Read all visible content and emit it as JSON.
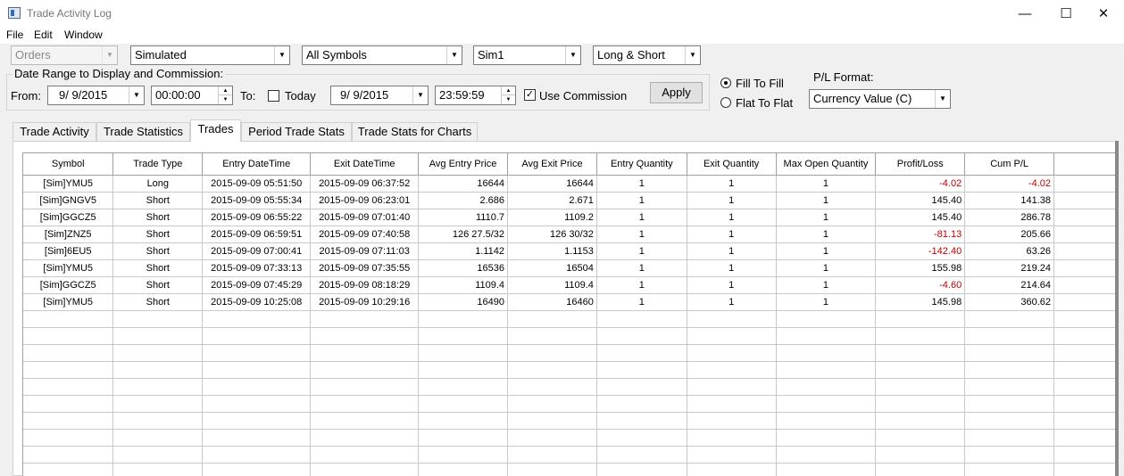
{
  "window": {
    "title": "Trade Activity Log",
    "minimize_glyph": "—",
    "maximize_glyph": "☐",
    "close_glyph": "✕"
  },
  "menu": [
    "File",
    "Edit",
    "Window"
  ],
  "filters": {
    "orders": "Orders",
    "mode": "Simulated",
    "symbols": "All Symbols",
    "account": "Sim1",
    "direction": "Long & Short"
  },
  "date_range": {
    "legend": "Date Range to Display and Commission:",
    "from_label": "From:",
    "from_date": "9/  9/2015",
    "from_time": "00:00:00",
    "to_label": "To:",
    "today_label": "Today",
    "today_checked": false,
    "to_date": "9/  9/2015",
    "to_time": "23:59:59",
    "use_commission_label": "Use Commission",
    "use_commission_checked": true,
    "apply_label": "Apply"
  },
  "fill_mode": {
    "fill_to_fill": "Fill To Fill",
    "flat_to_flat": "Flat To Flat",
    "selected": "fill_to_fill"
  },
  "pl_format": {
    "label": "P/L Format:",
    "value": "Currency Value (C)"
  },
  "tabs": [
    "Trade Activity",
    "Trade Statistics",
    "Trades",
    "Period Trade Stats",
    "Trade Stats for Charts"
  ],
  "active_tab": "Trades",
  "grid": {
    "columns": [
      "Symbol",
      "Trade Type",
      "Entry DateTime",
      "Exit DateTime",
      "Avg Entry Price",
      "Avg Exit Price",
      "Entry Quantity",
      "Exit Quantity",
      "Max Open Quantity",
      "Profit/Loss",
      "Cum P/L"
    ],
    "rows": [
      [
        "[Sim]YMU5",
        "Long",
        "2015-09-09  05:51:50",
        "2015-09-09  06:37:52",
        "16644",
        "16644",
        "1",
        "1",
        "1",
        "-4.02",
        "-4.02"
      ],
      [
        "[Sim]GNGV5",
        "Short",
        "2015-09-09  05:55:34",
        "2015-09-09  06:23:01",
        "2.686",
        "2.671",
        "1",
        "1",
        "1",
        "145.40",
        "141.38"
      ],
      [
        "[Sim]GGCZ5",
        "Short",
        "2015-09-09  06:55:22",
        "2015-09-09  07:01:40",
        "1110.7",
        "1109.2",
        "1",
        "1",
        "1",
        "145.40",
        "286.78"
      ],
      [
        "[Sim]ZNZ5",
        "Short",
        "2015-09-09  06:59:51",
        "2015-09-09  07:40:58",
        "126 27.5/32",
        "126 30/32",
        "1",
        "1",
        "1",
        "-81.13",
        "205.66"
      ],
      [
        "[Sim]6EU5",
        "Short",
        "2015-09-09  07:00:41",
        "2015-09-09  07:11:03",
        "1.1142",
        "1.1153",
        "1",
        "1",
        "1",
        "-142.40",
        "63.26"
      ],
      [
        "[Sim]YMU5",
        "Short",
        "2015-09-09  07:33:13",
        "2015-09-09  07:35:55",
        "16536",
        "16504",
        "1",
        "1",
        "1",
        "155.98",
        "219.24"
      ],
      [
        "[Sim]GGCZ5",
        "Short",
        "2015-09-09  07:45:29",
        "2015-09-09  08:18:29",
        "1109.4",
        "1109.4",
        "1",
        "1",
        "1",
        "-4.60",
        "214.64"
      ],
      [
        "[Sim]YMU5",
        "Short",
        "2015-09-09  10:25:08",
        "2015-09-09  10:29:16",
        "16490",
        "16460",
        "1",
        "1",
        "1",
        "145.98",
        "360.62"
      ]
    ],
    "empty_row_count": 10
  },
  "colors": {
    "negative": "#c00000",
    "grid_line": "#c8c8c8",
    "header_line": "#a0a0a0"
  }
}
